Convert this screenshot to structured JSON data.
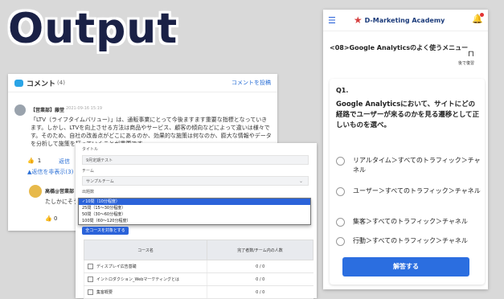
{
  "headline": "Output",
  "comments": {
    "title": "コメント",
    "count": "(4)",
    "post_label": "コメントを投稿",
    "first": {
      "author": "【営業部】藤堂",
      "date": "2021-09-16 15:19",
      "body": "「LTV（ライフタイムバリュー）」は、通販事業にとって今後ますます重要な指標となっていきます。しかし、LTVを向上させる方法は商品やサービス、顧客の傾向などによって違いは様々です。そのため、自社の改善点がどこにあるのか、効果的な施策は何なのか、膨大な情報やデータを分析して施策を打っていくことが重要です。",
      "likes": "1",
      "reply": "返信",
      "hide_replies": "▲返信を非表示(3)"
    },
    "second": {
      "author": "高橋@営業部",
      "body": "たしかにそう",
      "likes": "0"
    }
  },
  "filter": {
    "title_label": "タイトル",
    "title_value": "9月定期テスト",
    "team_label": "チーム",
    "team_value": "サンプルチーム",
    "questions_label": "出題数",
    "options": [
      "✓10問（10分程度）",
      "25問（15～30分程度）",
      "50問（30～60分程度）",
      "100問（60～120分程度）"
    ],
    "all_courses_button": "全コースを対象とする",
    "table": {
      "headers": [
        "コース名",
        "完了者数/チーム内の人数"
      ],
      "rows": [
        {
          "name": "ディスプレイ広告基礎",
          "ratio": "0 / 0"
        },
        {
          "name": "イントロダクション_Webマーケティングとは",
          "ratio": "0 / 0"
        },
        {
          "name": "集客概要",
          "ratio": "0 / 0"
        }
      ]
    }
  },
  "mobile": {
    "brand": "D-Marketing Academy",
    "heading": "<08>Google Analyticsのよく使うメニュー",
    "later_label": "後で復習",
    "question_no": "Q1.",
    "question": "Google Analyticsにおいて、サイトにどの経路でユーザーが来るのかを見る遷移として正しいものを選べ。",
    "options": [
      "リアルタイム＞すべてのトラフィック＞チャネル",
      "ユーザー＞すべてのトラフィック＞チャネル",
      "集客＞すべてのトラフィック＞チャネル",
      "行動＞すべてのトラフィック＞チャネル"
    ],
    "answer_button": "解答する"
  }
}
